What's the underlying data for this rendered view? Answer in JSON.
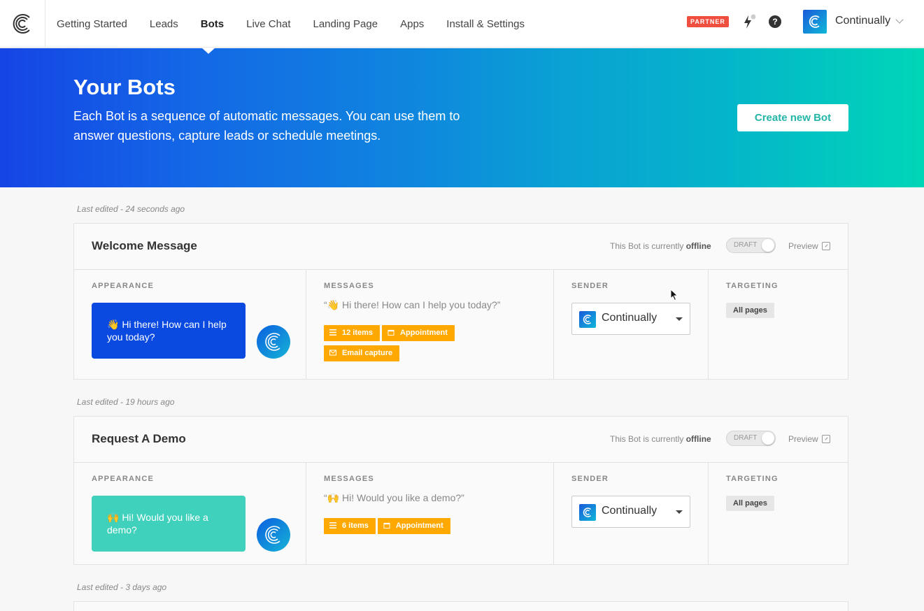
{
  "nav": {
    "items": [
      "Getting Started",
      "Leads",
      "Bots",
      "Live Chat",
      "Landing Page",
      "Apps",
      "Install & Settings"
    ],
    "active": "Bots",
    "partner_badge": "PARTNER",
    "help_glyph": "?",
    "account_name": "Continually"
  },
  "hero": {
    "title": "Your Bots",
    "description": "Each Bot is a sequence of automatic messages. You can use them to answer questions, capture leads or schedule meetings.",
    "create_button": "Create new Bot"
  },
  "columns": {
    "appearance": "APPEARANCE",
    "messages": "MESSAGES",
    "sender": "SENDER",
    "targeting": "TARGETING"
  },
  "status": {
    "prefix": "This Bot is currently",
    "state": "offline",
    "toggle_label": "DRAFT",
    "preview": "Preview"
  },
  "bots": [
    {
      "last_edited": "Last edited - 24 seconds ago",
      "name": "Welcome Message",
      "bubble_text": "👋 Hi there! How can I help you today?",
      "bubble_color": "#0a4ae0",
      "message_quote": "“👋 Hi there! How can I help you today?”",
      "tags": [
        {
          "icon": "list-icon",
          "label": "12 items"
        },
        {
          "icon": "calendar-icon",
          "label": "Appointment"
        },
        {
          "icon": "envelope-icon",
          "label": "Email capture"
        }
      ],
      "sender": "Continually",
      "targeting": "All pages"
    },
    {
      "last_edited": "Last edited - 19 hours ago",
      "name": "Request A Demo",
      "bubble_text": "🙌 Hi! Would you like a demo?",
      "bubble_color": "#40d1bd",
      "message_quote": "“🙌 Hi! Would you like a demo?”",
      "tags": [
        {
          "icon": "list-icon",
          "label": "6 items"
        },
        {
          "icon": "calendar-icon",
          "label": "Appointment"
        }
      ],
      "sender": "Continually",
      "targeting": "All pages"
    }
  ],
  "third_last_edited": "Last edited - 3 days ago",
  "colors": {
    "accent": "#22b5a8",
    "tag": "#ffa800",
    "partner": "#f04e3e"
  }
}
